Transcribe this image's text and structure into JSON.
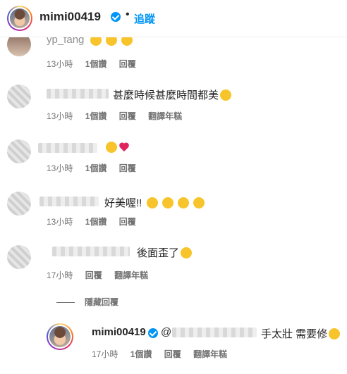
{
  "header": {
    "username": "mimi00419",
    "separator": "•",
    "follow_label": "追蹤",
    "avatar_icon": "profile-avatar",
    "verified_icon": "verified-badge-icon"
  },
  "comments": [
    {
      "username_visible": "yp_fang",
      "text": "",
      "emojis": [
        "clapping-hands",
        "grinning-face",
        "clapping-hands"
      ],
      "time": "13小時",
      "likes": "1個讚",
      "reply": "回覆",
      "translate": ""
    },
    {
      "text": "甚麼時候甚麼時間都美",
      "emojis": [
        "star-struck-face"
      ],
      "time": "13小時",
      "likes": "1個讚",
      "reply": "回覆",
      "translate": "翻譯年糕"
    },
    {
      "text": "",
      "emojis": [
        "face-blowing-kiss",
        "red-heart"
      ],
      "time": "13小時",
      "likes": "1個讚",
      "reply": "回覆",
      "translate": ""
    },
    {
      "text": "好美喔!!",
      "emojis": [
        "face-blowing-kiss",
        "face-blowing-kiss",
        "face-blowing-kiss",
        "face-blowing-kiss"
      ],
      "time": "13小時",
      "likes": "1個讚",
      "reply": "回覆",
      "translate": ""
    },
    {
      "text": "後面歪了",
      "emojis": [
        "grinning-face-with-sweat"
      ],
      "time": "17小時",
      "likes": "",
      "reply": "回覆",
      "translate": "翻譯年糕"
    }
  ],
  "hide_replies_label": "隱藏回覆",
  "reply": {
    "username": "mimi00419",
    "mention_prefix": "@",
    "text": "手太壯 需要修",
    "emojis": [
      "rolling-on-the-floor-laughing"
    ],
    "time": "17小時",
    "likes": "1個讚",
    "reply": "回覆",
    "translate": "翻譯年糕"
  },
  "colors": {
    "accent": "#0095f6",
    "meta": "#737373",
    "text": "#262626"
  }
}
